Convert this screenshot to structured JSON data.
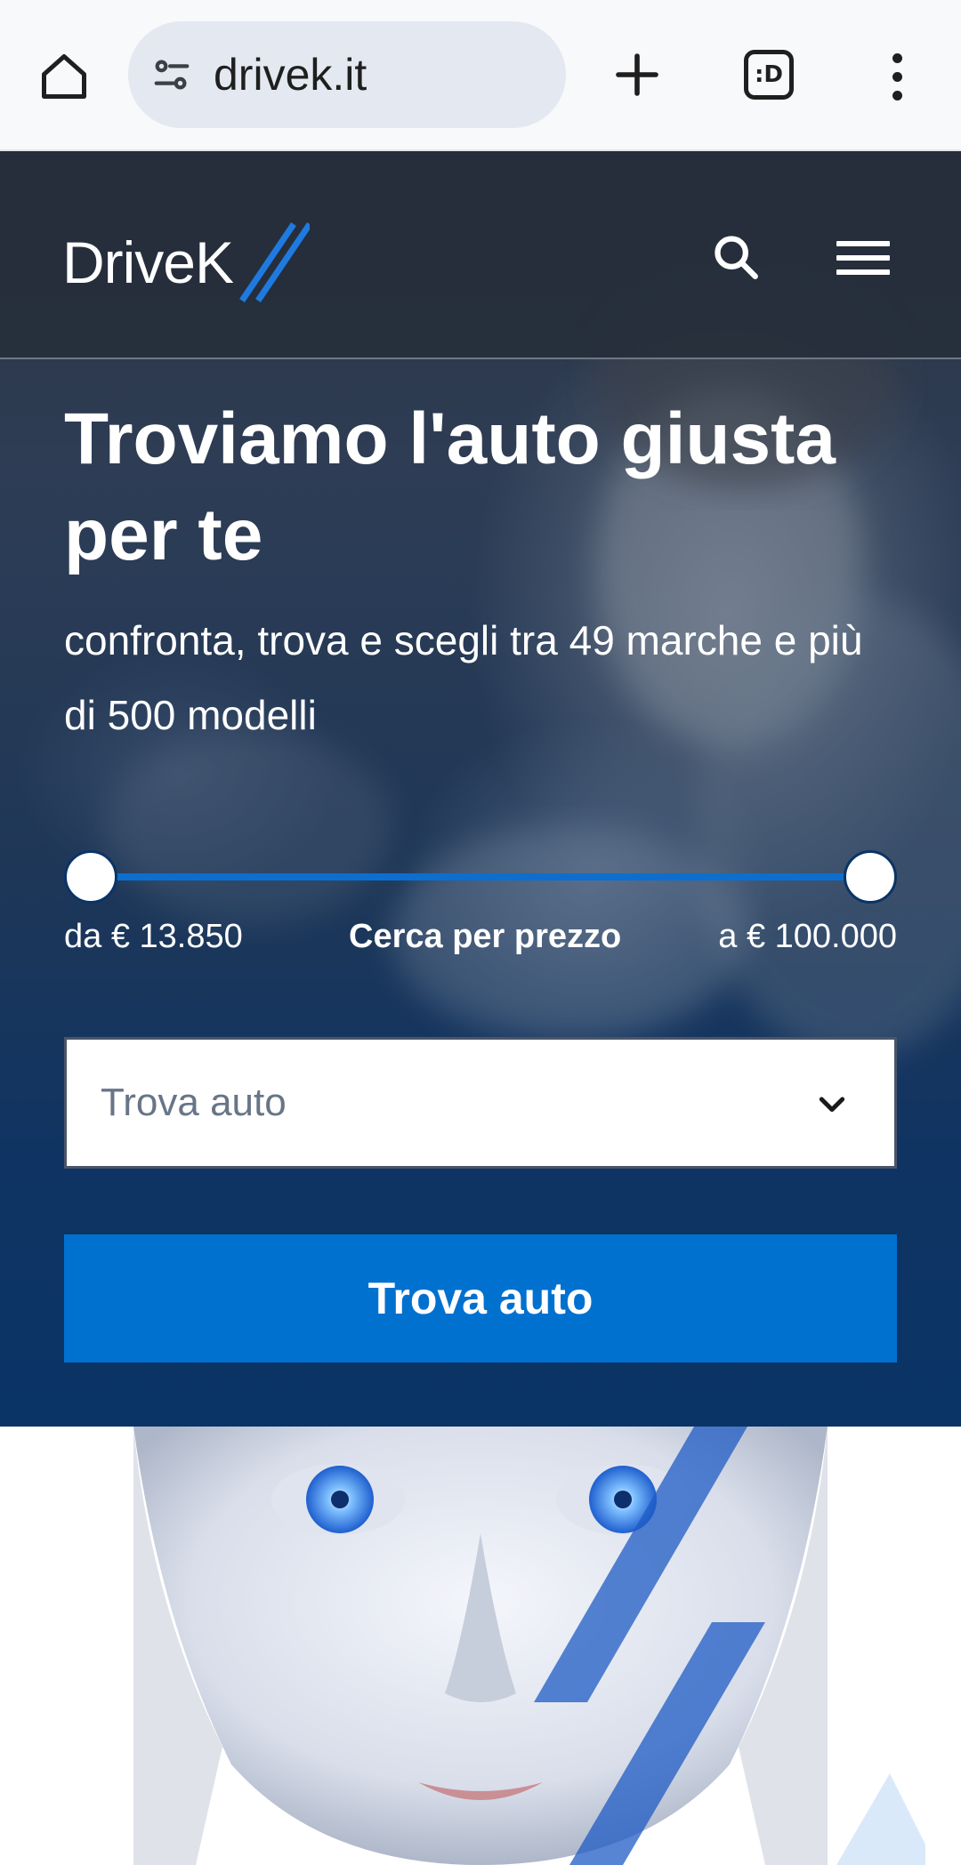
{
  "browser": {
    "url": "drivek.it",
    "tabs_label": ":D",
    "icons": [
      "home-icon",
      "site-settings-icon",
      "new-tab-icon",
      "tabs-icon",
      "more-vert-icon"
    ]
  },
  "header": {
    "logo_text": "DriveK",
    "icons": [
      "search-icon",
      "hamburger-menu-icon"
    ]
  },
  "hero": {
    "title": "Troviamo l'auto giusta per te",
    "subtitle": "confronta, trova e scegli tra 49 marche e più di 500 modelli"
  },
  "price_filter": {
    "min_label": "da € 13.850",
    "center_label": "Cerca per prezzo",
    "max_label": "a € 100.000",
    "range_fraction": [
      0.0,
      1.0
    ]
  },
  "search": {
    "select_placeholder": "Trova auto",
    "button_label": "Trova auto"
  },
  "colors": {
    "accent": "#0171d0",
    "header_bg": "#262d3a",
    "hero_bottom": "#0a3466"
  }
}
